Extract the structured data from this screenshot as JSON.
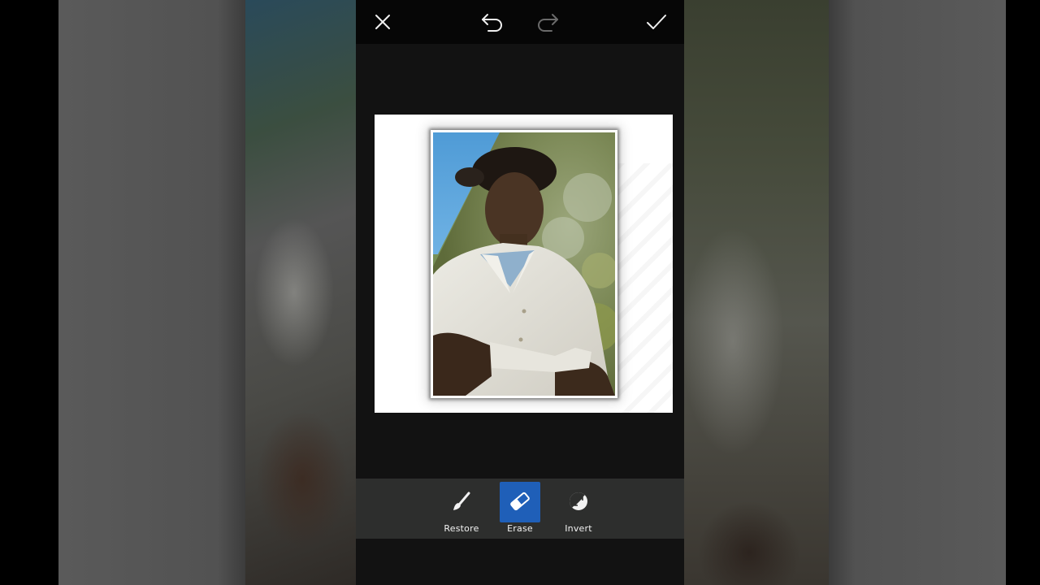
{
  "app": {
    "topbar": {
      "close_icon": "close-icon",
      "undo_icon": "undo-icon",
      "redo_icon": "redo-icon",
      "apply_icon": "checkmark-icon",
      "redo_enabled": false
    },
    "canvas": {
      "background": "#ffffff",
      "image": "portrait photo of young man in white shirt with blue sky corner"
    },
    "tools": [
      {
        "label": "Restore",
        "icon": "brush-icon",
        "selected": false
      },
      {
        "label": "Erase",
        "icon": "eraser-icon",
        "selected": true
      },
      {
        "label": "Invert",
        "icon": "invert-icon",
        "selected": false
      }
    ],
    "colors": {
      "selected_tool": "#1f5fb8",
      "toolbar_bg": "#2d2e2d",
      "app_bg": "#121212"
    }
  }
}
